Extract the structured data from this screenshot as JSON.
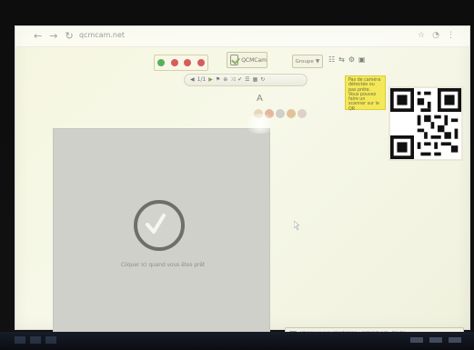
{
  "browser": {
    "url": "qcmcam.net"
  },
  "toolbar": {
    "icons": [
      "plus-icon",
      "next-icon",
      "back-icon",
      "home-icon"
    ]
  },
  "brand": {
    "name": "QCMCam"
  },
  "groups": {
    "label": "Groupe",
    "arrow": "▼"
  },
  "question_nav": {
    "position": "1/1"
  },
  "question": {
    "title": "A"
  },
  "camera_note": {
    "text": "Pas de caméra détectée ou pas prête. Vous pouvez faire un scanner sur le QR"
  },
  "ready": {
    "label": "Cliquer ici quand vous êtes prêt"
  },
  "footer": {
    "text": "Utiliser pour le smartphone : qcmcam.net - Pas besoin de lancer de QR-code avec cette interface"
  },
  "colors": {
    "panel": "#cfd0c9",
    "note": "#f4e85a",
    "green": "#7ca14a",
    "red": "#d85c5c"
  }
}
